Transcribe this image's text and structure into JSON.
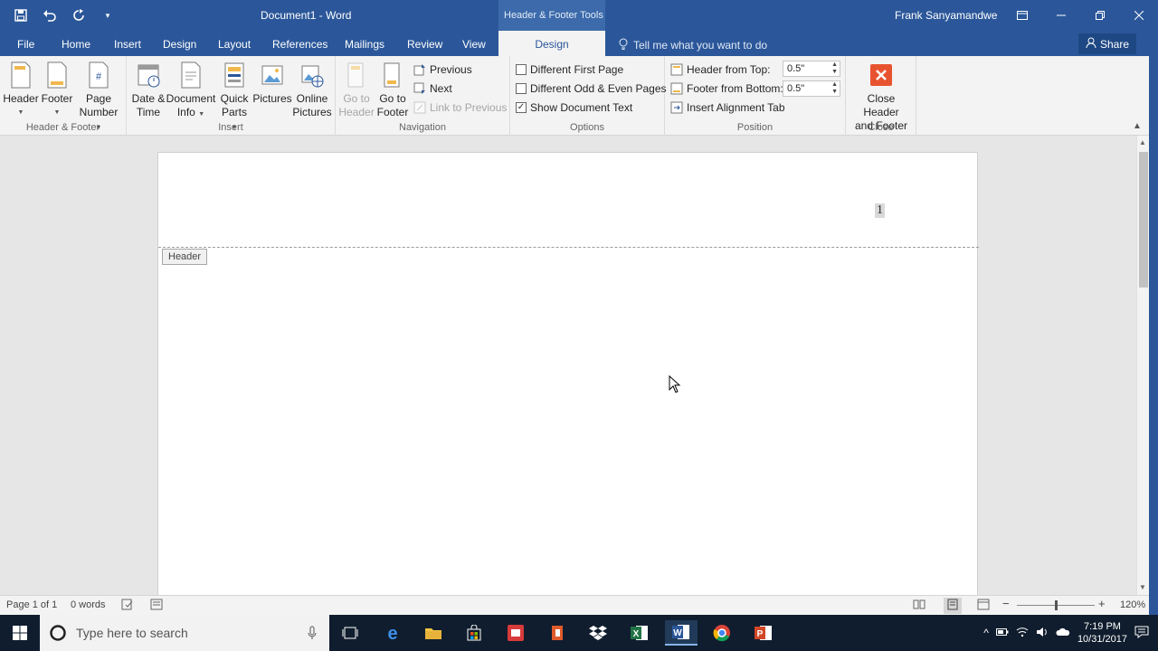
{
  "titlebar": {
    "doc_title": "Document1  -  Word",
    "context_tab": "Header & Footer Tools",
    "user": "Frank Sanyamandwe"
  },
  "tabs": [
    {
      "label": "File"
    },
    {
      "label": "Home"
    },
    {
      "label": "Insert"
    },
    {
      "label": "Design"
    },
    {
      "label": "Layout"
    },
    {
      "label": "References"
    },
    {
      "label": "Mailings"
    },
    {
      "label": "Review"
    },
    {
      "label": "View"
    },
    {
      "label": "Design"
    }
  ],
  "tell_me": "Tell me what you want to do",
  "share": "Share",
  "ribbon": {
    "hf_group": {
      "label": "Header & Footer",
      "header": "Header",
      "footer": "Footer",
      "page_number_1": "Page",
      "page_number_2": "Number"
    },
    "insert_group": {
      "label": "Insert",
      "date_time_1": "Date &",
      "date_time_2": "Time",
      "doc_info_1": "Document",
      "doc_info_2": "Info",
      "quick_parts_1": "Quick",
      "quick_parts_2": "Parts",
      "pictures": "Pictures",
      "online_pictures_1": "Online",
      "online_pictures_2": "Pictures"
    },
    "nav_group": {
      "label": "Navigation",
      "go_header_1": "Go to",
      "go_header_2": "Header",
      "go_footer_1": "Go to",
      "go_footer_2": "Footer",
      "previous": "Previous",
      "next": "Next",
      "link_previous": "Link to Previous"
    },
    "options_group": {
      "label": "Options",
      "diff_first": "Different First Page",
      "diff_odd_even": "Different Odd & Even Pages",
      "show_doc_text": "Show Document Text",
      "diff_first_checked": false,
      "diff_odd_even_checked": false,
      "show_doc_text_checked": true
    },
    "position_group": {
      "label": "Position",
      "header_from_top": "Header from Top:",
      "header_from_top_value": "0.5\"",
      "footer_from_bottom": "Footer from Bottom:",
      "footer_from_bottom_value": "0.5\"",
      "insert_alignment_tab": "Insert Alignment Tab"
    },
    "close_group": {
      "label": "Close",
      "close_1": "Close Header",
      "close_2": "and Footer"
    }
  },
  "document": {
    "page_number": "1",
    "header_tag": "Header"
  },
  "status": {
    "page": "Page 1 of 1",
    "words": "0 words",
    "zoom": "120%"
  },
  "taskbar": {
    "search_placeholder": "Type here to search",
    "time": "7:19 PM",
    "date": "10/31/2017"
  },
  "colors": {
    "word_blue": "#2b579a",
    "close_red": "#e8532f"
  }
}
